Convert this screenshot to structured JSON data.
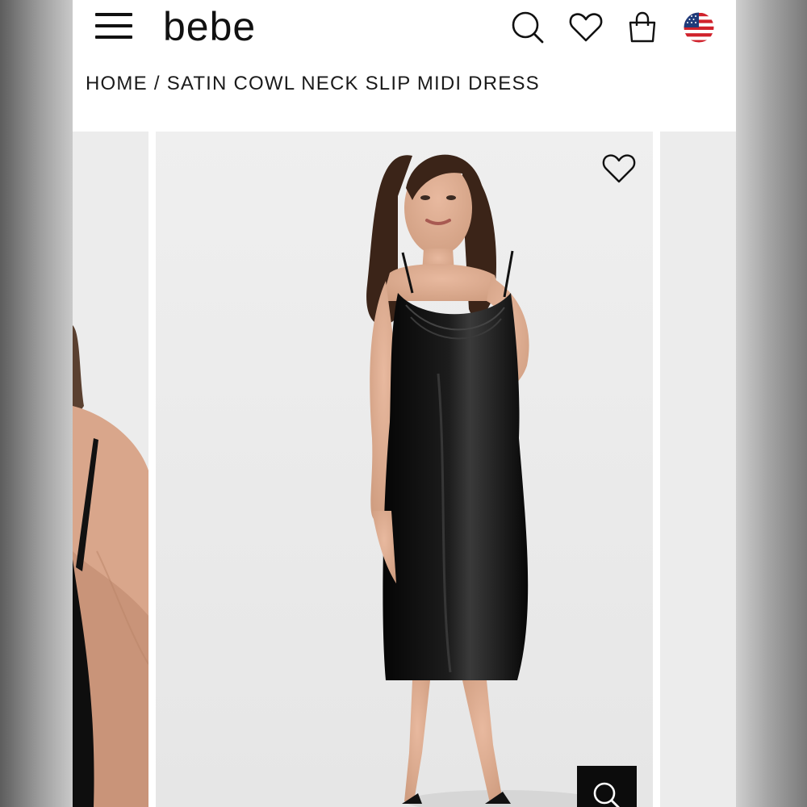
{
  "header": {
    "brand": "bebe",
    "icons": [
      "menu-icon",
      "search-icon",
      "heart-icon",
      "shopping-bag-icon",
      "us-flag-icon"
    ]
  },
  "breadcrumb": {
    "home": "HOME",
    "separator": "/",
    "current": "SATIN COWL NECK SLIP MIDI DRESS"
  },
  "gallery": {
    "wishlist_icon": "heart-outline-icon",
    "zoom_icon": "search-icon"
  },
  "colors": {
    "background": "#ffffff",
    "text": "#111111",
    "image_bg": "#ececec",
    "dress": "#0d0d0d",
    "zoom_button": "#0c0c0c"
  }
}
